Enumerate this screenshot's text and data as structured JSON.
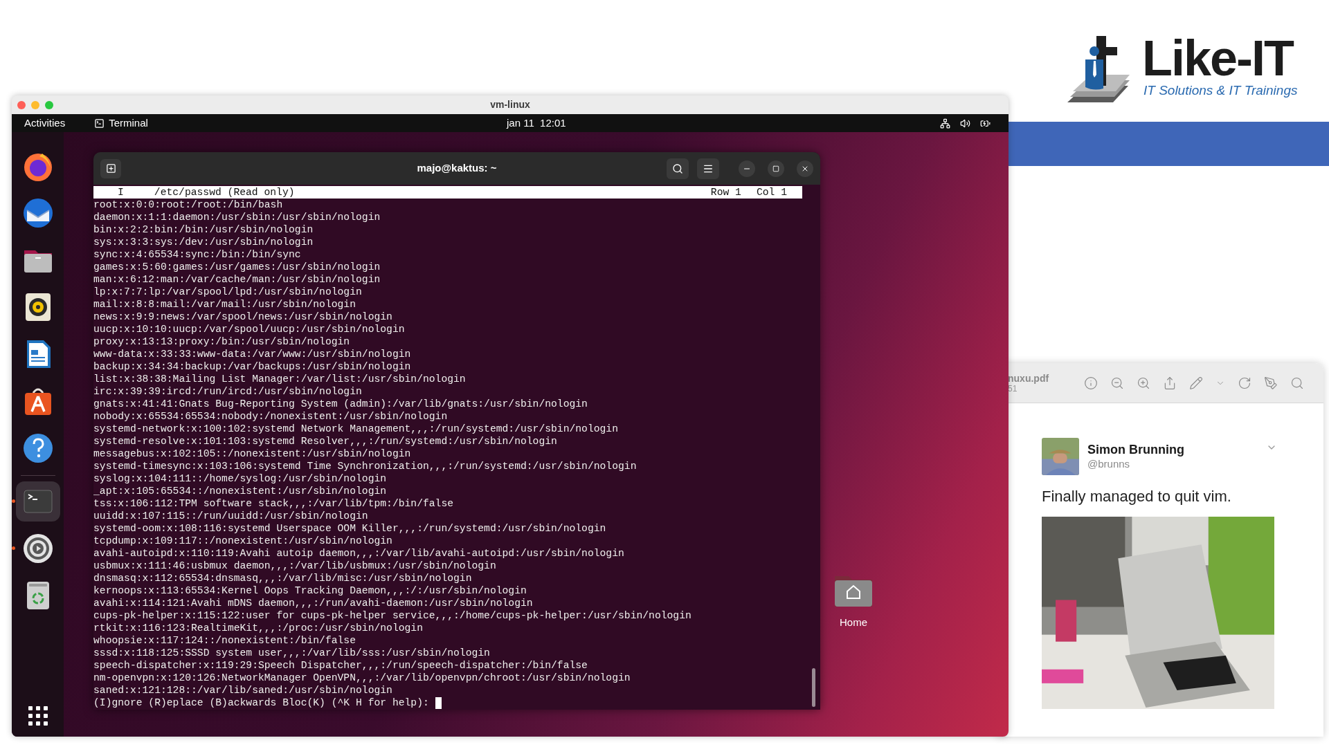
{
  "logo": {
    "name": "Like-IT",
    "tagline": "IT Solutions & IT Trainings"
  },
  "vm_window": {
    "title": "vm-linux"
  },
  "top_bar": {
    "activities": "Activities",
    "app": "Terminal",
    "clock": "jan 11  12:01"
  },
  "dock": [
    {
      "kind": "firefox",
      "running": false,
      "selected": false
    },
    {
      "kind": "mail",
      "running": false,
      "selected": false
    },
    {
      "kind": "files",
      "running": false,
      "selected": false
    },
    {
      "kind": "speaker",
      "running": false,
      "selected": false
    },
    {
      "kind": "writer",
      "running": false,
      "selected": false
    },
    {
      "kind": "store",
      "running": false,
      "selected": false
    },
    {
      "kind": "help",
      "running": false,
      "selected": false
    },
    {
      "kind": "terminal",
      "running": true,
      "selected": true
    },
    {
      "kind": "settings",
      "running": true,
      "selected": false
    },
    {
      "kind": "trash",
      "running": false,
      "selected": false
    }
  ],
  "terminal": {
    "title": "majo@kaktus: ~",
    "status": {
      "mode": "I",
      "file": "/etc/passwd (Read only)",
      "row": "Row 1",
      "col": "Col 1"
    },
    "lines": [
      "root:x:0:0:root:/root:/bin/bash",
      "daemon:x:1:1:daemon:/usr/sbin:/usr/sbin/nologin",
      "bin:x:2:2:bin:/bin:/usr/sbin/nologin",
      "sys:x:3:3:sys:/dev:/usr/sbin/nologin",
      "sync:x:4:65534:sync:/bin:/bin/sync",
      "games:x:5:60:games:/usr/games:/usr/sbin/nologin",
      "man:x:6:12:man:/var/cache/man:/usr/sbin/nologin",
      "lp:x:7:7:lp:/var/spool/lpd:/usr/sbin/nologin",
      "mail:x:8:8:mail:/var/mail:/usr/sbin/nologin",
      "news:x:9:9:news:/var/spool/news:/usr/sbin/nologin",
      "uucp:x:10:10:uucp:/var/spool/uucp:/usr/sbin/nologin",
      "proxy:x:13:13:proxy:/bin:/usr/sbin/nologin",
      "www-data:x:33:33:www-data:/var/www:/usr/sbin/nologin",
      "backup:x:34:34:backup:/var/backups:/usr/sbin/nologin",
      "list:x:38:38:Mailing List Manager:/var/list:/usr/sbin/nologin",
      "irc:x:39:39:ircd:/run/ircd:/usr/sbin/nologin",
      "gnats:x:41:41:Gnats Bug-Reporting System (admin):/var/lib/gnats:/usr/sbin/nologin",
      "nobody:x:65534:65534:nobody:/nonexistent:/usr/sbin/nologin",
      "systemd-network:x:100:102:systemd Network Management,,,:/run/systemd:/usr/sbin/nologin",
      "systemd-resolve:x:101:103:systemd Resolver,,,:/run/systemd:/usr/sbin/nologin",
      "messagebus:x:102:105::/nonexistent:/usr/sbin/nologin",
      "systemd-timesync:x:103:106:systemd Time Synchronization,,,:/run/systemd:/usr/sbin/nologin",
      "syslog:x:104:111::/home/syslog:/usr/sbin/nologin",
      "_apt:x:105:65534::/nonexistent:/usr/sbin/nologin",
      "tss:x:106:112:TPM software stack,,,:/var/lib/tpm:/bin/false",
      "uuidd:x:107:115::/run/uuidd:/usr/sbin/nologin",
      "systemd-oom:x:108:116:systemd Userspace OOM Killer,,,:/run/systemd:/usr/sbin/nologin",
      "tcpdump:x:109:117::/nonexistent:/usr/sbin/nologin",
      "avahi-autoipd:x:110:119:Avahi autoip daemon,,,:/var/lib/avahi-autoipd:/usr/sbin/nologin",
      "usbmux:x:111:46:usbmux daemon,,,:/var/lib/usbmux:/usr/sbin/nologin",
      "dnsmasq:x:112:65534:dnsmasq,,,:/var/lib/misc:/usr/sbin/nologin",
      "kernoops:x:113:65534:Kernel Oops Tracking Daemon,,,:/:/usr/sbin/nologin",
      "avahi:x:114:121:Avahi mDNS daemon,,,:/run/avahi-daemon:/usr/sbin/nologin",
      "cups-pk-helper:x:115:122:user for cups-pk-helper service,,,:/home/cups-pk-helper:/usr/sbin/nologin",
      "rtkit:x:116:123:RealtimeKit,,,:/proc:/usr/sbin/nologin",
      "whoopsie:x:117:124::/nonexistent:/bin/false",
      "sssd:x:118:125:SSSD system user,,,:/var/lib/sss:/usr/sbin/nologin",
      "speech-dispatcher:x:119:29:Speech Dispatcher,,,:/run/speech-dispatcher:/bin/false",
      "nm-openvpn:x:120:126:NetworkManager OpenVPN,,,:/var/lib/openvpn/chroot:/usr/sbin/nologin",
      "saned:x:121:128::/var/lib/saned:/usr/sbin/nologin"
    ],
    "prompt": "(I)gnore (R)eplace (B)ackwards Bloc(K) (^K H for help):"
  },
  "desktop_icon": {
    "label": "Home"
  },
  "pdf_viewer": {
    "filename": "nuxu.pdf",
    "page": "51",
    "tweet": {
      "name": "Simon Brunning",
      "handle": "@brunns",
      "text": "Finally managed to quit vim."
    }
  }
}
